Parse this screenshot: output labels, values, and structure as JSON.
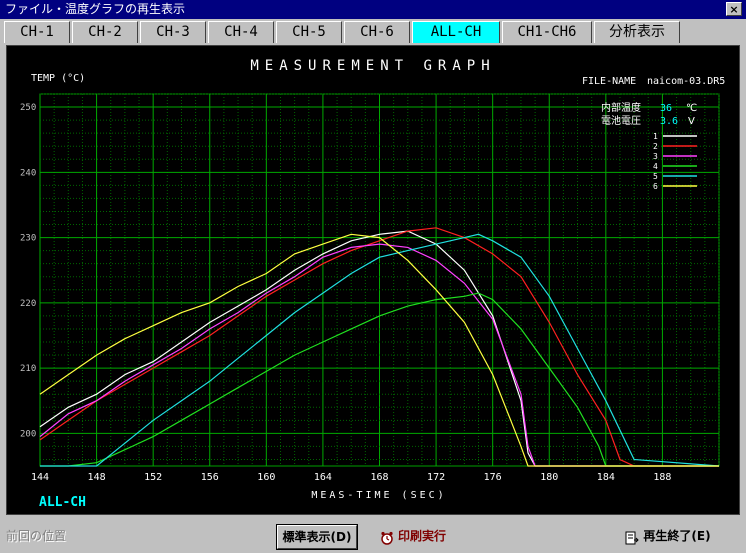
{
  "window": {
    "title": "ファイル・温度グラフの再生表示",
    "close_label": "×"
  },
  "tabs": [
    {
      "label": "CH-1",
      "active": false
    },
    {
      "label": "CH-2",
      "active": false
    },
    {
      "label": "CH-3",
      "active": false
    },
    {
      "label": "CH-4",
      "active": false
    },
    {
      "label": "CH-5",
      "active": false
    },
    {
      "label": "CH-6",
      "active": false
    },
    {
      "label": "ALL-CH",
      "active": true
    },
    {
      "label": "CH1-CH6",
      "active": false
    },
    {
      "label": "分析表示",
      "active": false
    }
  ],
  "graph": {
    "heading": "MEASUREMENT GRAPH",
    "file_name_label": "FILE-NAME",
    "file_name": "naicom-03.DR5",
    "channel_caption": "ALL-CH",
    "internal_temp_label": "内部温度",
    "internal_temp_value": "36",
    "internal_temp_unit": "℃",
    "battery_label": "電池電圧",
    "battery_value": "3.6",
    "battery_unit": "V"
  },
  "chart_data": {
    "type": "line",
    "title": "MEASUREMENT GRAPH",
    "xlabel": "MEAS-TIME (SEC)",
    "ylabel": "TEMP (°C)",
    "xlim": [
      144,
      192
    ],
    "ylim": [
      195,
      252
    ],
    "xticks": [
      144,
      148,
      152,
      156,
      160,
      164,
      168,
      172,
      176,
      180,
      184,
      188
    ],
    "xtick_labels": [
      "144",
      "148",
      "152",
      "156",
      "160",
      "164",
      "168",
      "172",
      "176",
      "180",
      "184",
      "188"
    ],
    "yticks": [
      200,
      210,
      220,
      230,
      240,
      250
    ],
    "grid": true,
    "legend_position": "top-right",
    "series": [
      {
        "name": "1",
        "color": "#ffffff",
        "x": [
          144,
          146,
          148,
          150,
          152,
          154,
          156,
          158,
          160,
          162,
          164,
          166,
          168,
          170,
          172,
          174,
          176,
          178,
          178.5,
          179,
          180,
          192
        ],
        "values": [
          201,
          204,
          206,
          209,
          211,
          214,
          217,
          219.5,
          222,
          225,
          227.5,
          229.5,
          230.5,
          231,
          229,
          225,
          218,
          205,
          197,
          195,
          195,
          195
        ]
      },
      {
        "name": "2",
        "color": "#ff2020",
        "x": [
          144,
          146,
          148,
          150,
          152,
          154,
          156,
          158,
          160,
          162,
          164,
          166,
          168,
          170,
          172,
          174,
          176,
          178,
          180,
          182,
          184,
          185,
          186,
          192
        ],
        "values": [
          199,
          202,
          205,
          207.5,
          210,
          212.5,
          215,
          218,
          221,
          223.5,
          226,
          228,
          229.5,
          231,
          231.5,
          230,
          227.5,
          224,
          217,
          209,
          202,
          196,
          195,
          195
        ]
      },
      {
        "name": "3",
        "color": "#ff40ff",
        "x": [
          144,
          146,
          148,
          150,
          152,
          154,
          156,
          158,
          160,
          162,
          164,
          166,
          168,
          170,
          172,
          174,
          176,
          178,
          178.5,
          179,
          180,
          192
        ],
        "values": [
          199.5,
          203,
          205,
          208,
          210.5,
          213,
          216,
          218.5,
          221.5,
          224,
          227,
          228.5,
          229,
          228.5,
          226.5,
          223,
          217.5,
          206,
          198,
          195,
          195,
          195
        ]
      },
      {
        "name": "4",
        "color": "#20e020",
        "x": [
          144,
          146,
          148,
          150,
          152,
          154,
          156,
          158,
          160,
          162,
          164,
          166,
          168,
          170,
          172,
          174,
          175,
          176,
          178,
          180,
          182,
          183.5,
          184,
          192
        ],
        "values": [
          195,
          195,
          195.5,
          197.5,
          199.5,
          202,
          204.5,
          207,
          209.5,
          212,
          214,
          216,
          218,
          219.5,
          220.5,
          221,
          221.5,
          220.5,
          216,
          210,
          204,
          198,
          195,
          195
        ]
      },
      {
        "name": "5",
        "color": "#20e0e0",
        "x": [
          144,
          146,
          148,
          150,
          152,
          154,
          156,
          158,
          160,
          162,
          164,
          166,
          168,
          170,
          172,
          174,
          175,
          176,
          178,
          180,
          182,
          184,
          186,
          192
        ],
        "values": [
          195,
          195,
          195,
          198.5,
          202,
          205,
          208,
          211.5,
          215,
          218.5,
          221.5,
          224.5,
          227,
          228,
          229,
          230,
          230.5,
          229.5,
          227,
          221,
          213,
          205,
          196,
          195
        ]
      },
      {
        "name": "6",
        "color": "#ffff40",
        "x": [
          144,
          146,
          148,
          150,
          152,
          154,
          156,
          158,
          160,
          162,
          164,
          166,
          168,
          170,
          172,
          174,
          176,
          178,
          178.5,
          192
        ],
        "values": [
          206,
          209,
          212,
          214.5,
          216.5,
          218.5,
          220,
          222.5,
          224.5,
          227.5,
          229,
          230.5,
          230,
          226.5,
          222,
          217,
          209,
          198,
          195,
          195
        ]
      }
    ]
  },
  "statusbar": {
    "prev_position_label": "前回の位置",
    "standard_display_label": "標準表示(D)",
    "print_label": "印刷実行",
    "end_label": "再生終了(E)"
  },
  "colors": {
    "background": "#c0c0c0",
    "title_bar": "#000080",
    "active_tab": "#00ffff",
    "grid": "#008800",
    "axis_text": "#ffffff",
    "caption": "#00ffff"
  }
}
